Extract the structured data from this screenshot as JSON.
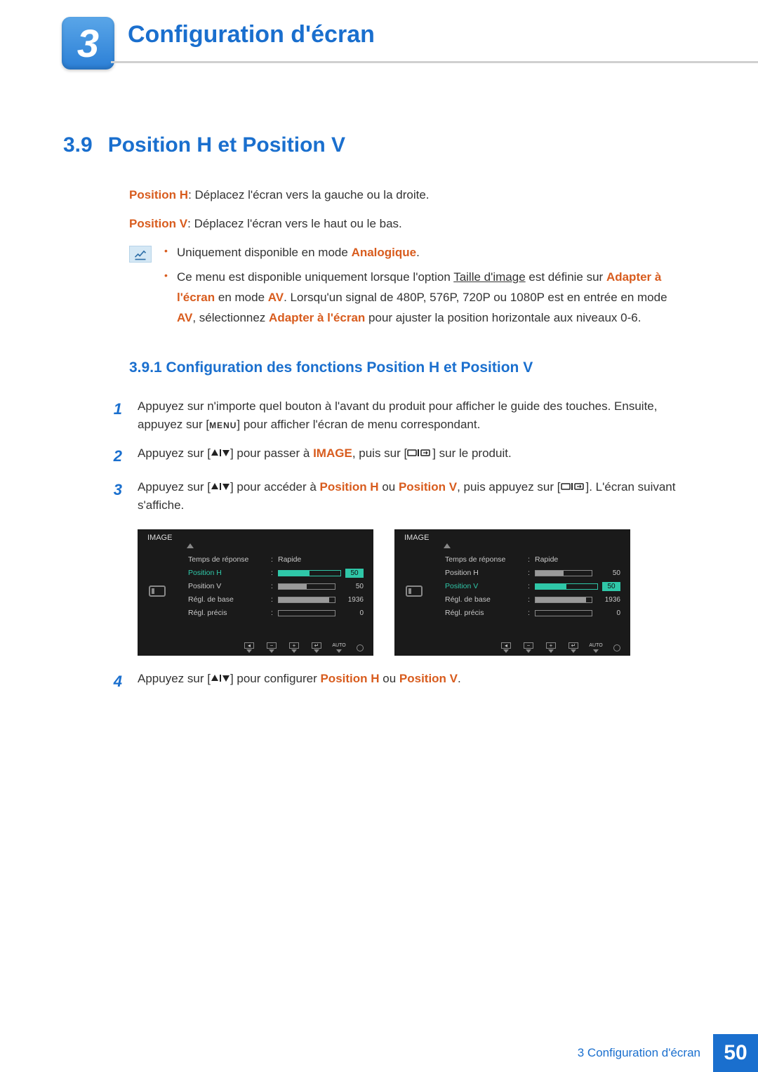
{
  "chapter": {
    "number": "3",
    "title": "Configuration d'écran"
  },
  "section": {
    "number": "3.9",
    "title": "Position H et Position V"
  },
  "intro": {
    "posH_label": "Position H",
    "posH_text": ": Déplacez l'écran vers la gauche ou la droite.",
    "posV_label": "Position V",
    "posV_text": ": Déplacez l'écran vers le haut ou le bas."
  },
  "notes": {
    "n1_a": "Uniquement disponible en mode ",
    "n1_b": "Analogique",
    "n1_c": ".",
    "n2_a": "Ce menu est disponible uniquement lorsque l'option ",
    "n2_link": "Taille d'image",
    "n2_b": " est définie sur ",
    "n2_c": "Adapter à l'écran",
    "n2_d": " en mode ",
    "n2_e": "AV",
    "n2_f": ". Lorsqu'un signal de 480P, 576P, 720P ou 1080P est en entrée en mode ",
    "n2_g": "AV",
    "n2_h": ", sélectionnez ",
    "n2_i": "Adapter à l'écran",
    "n2_j": " pour ajuster la position horizontale aux niveaux 0-6."
  },
  "subsection": "3.9.1  Configuration des fonctions Position H et Position V",
  "steps": {
    "s1_num": "1",
    "s1": "Appuyez sur n'importe quel bouton à l'avant du produit pour afficher le guide des touches. Ensuite, appuyez sur [",
    "s1_menu": "MENU",
    "s1_b": "] pour afficher l'écran de menu correspondant.",
    "s2_num": "2",
    "s2_a": "Appuyez sur [",
    "s2_b": "] pour passer à ",
    "s2_img": "IMAGE",
    "s2_c": ", puis sur [",
    "s2_d": "] sur le produit.",
    "s3_num": "3",
    "s3_a": "Appuyez sur [",
    "s3_b": "] pour accéder à ",
    "s3_c": "Position H",
    "s3_d": " ou ",
    "s3_e": "Position V",
    "s3_f": ", puis appuyez sur [",
    "s3_g": "]. L'écran suivant s'affiche.",
    "s4_num": "4",
    "s4_a": "Appuyez sur [",
    "s4_b": "] pour configurer ",
    "s4_c": "Position H",
    "s4_d": " ou ",
    "s4_e": "Position V",
    "s4_f": "."
  },
  "osd": {
    "header": "IMAGE",
    "rows": [
      {
        "label": "Temps de réponse",
        "value_text": "Rapide"
      },
      {
        "label": "Position H",
        "value": "50",
        "fill": 50
      },
      {
        "label": "Position V",
        "value": "50",
        "fill": 50
      },
      {
        "label": "Régl. de base",
        "value": "1936",
        "fill": 90
      },
      {
        "label": "Régl. précis",
        "value": "0",
        "fill": 0
      }
    ],
    "highlight_left": 1,
    "highlight_right": 2,
    "bottom_auto": "AUTO"
  },
  "footer": {
    "label": "3 Configuration d'écran",
    "page": "50"
  }
}
